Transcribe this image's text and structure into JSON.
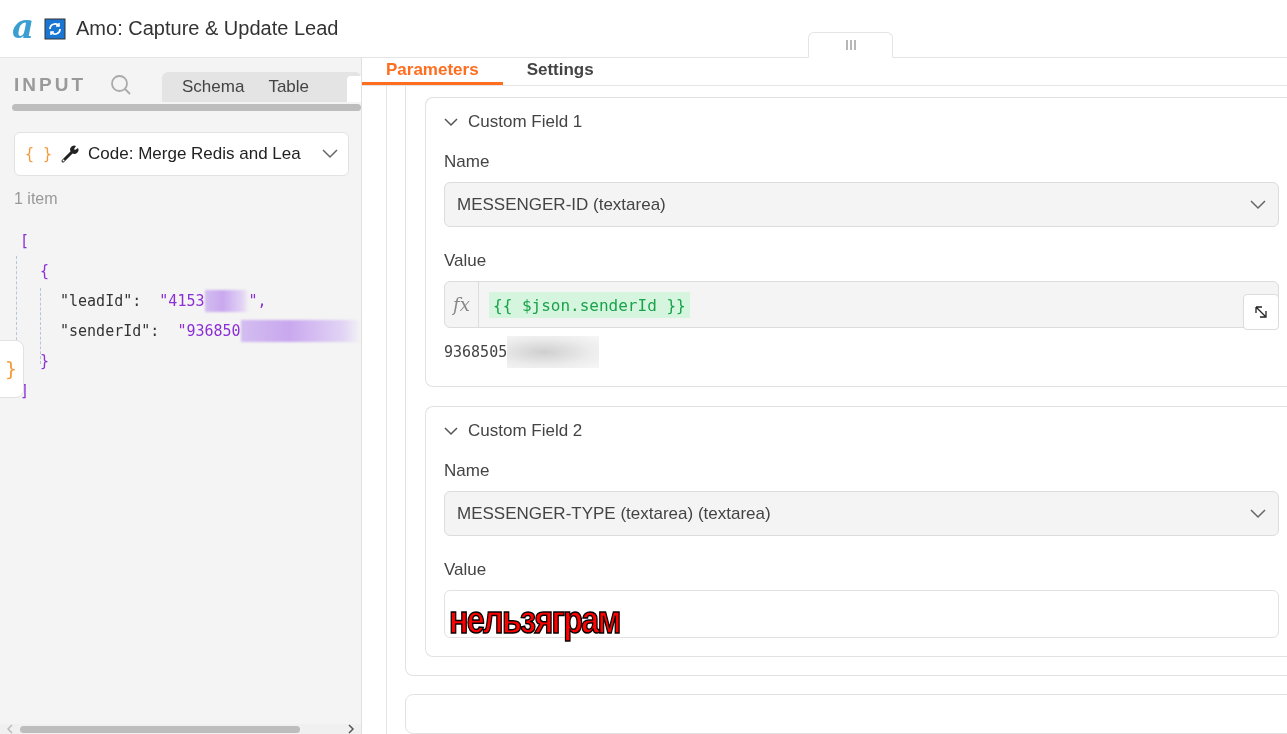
{
  "header": {
    "logo": "a",
    "title": "Amo: Capture & Update Lead"
  },
  "input_panel": {
    "label": "INPUT",
    "tabs": [
      {
        "label": "Schema",
        "selected": false
      },
      {
        "label": "Table",
        "selected": false
      }
    ],
    "source_select": {
      "icon_text": "{ }",
      "value": "Code: Merge Redis and Lea"
    },
    "item_count": "1 item",
    "json_lines": [
      {
        "kind": "open",
        "text": "["
      },
      {
        "kind": "open",
        "text": "{"
      },
      {
        "kind": "pair",
        "key": "\"leadId\":",
        "value": "\"4153",
        "tail": "\","
      },
      {
        "kind": "pair",
        "key": "\"senderId\":",
        "value": "\"936850"
      },
      {
        "kind": "close",
        "text": "}"
      },
      {
        "kind": "close",
        "text": "]"
      }
    ],
    "side_button": "}"
  },
  "parameters_panel": {
    "tabs": [
      {
        "label": "Parameters",
        "selected": true
      },
      {
        "label": "Settings",
        "selected": false
      }
    ],
    "fields": [
      {
        "title": "Custom Field 1",
        "expanded": true,
        "name_label": "Name",
        "name_value": "MESSENGER-ID (textarea)",
        "value_label": "Value",
        "kind": "expression",
        "fx": "fx",
        "expression": "{{ $json.senderId }}",
        "preview": "9368505"
      },
      {
        "title": "Custom Field 2",
        "expanded": true,
        "name_label": "Name",
        "name_value": "MESSENGER-TYPE (textarea) (textarea)",
        "value_label": "Value",
        "kind": "fixed",
        "value": "нельзяграм"
      }
    ]
  }
}
